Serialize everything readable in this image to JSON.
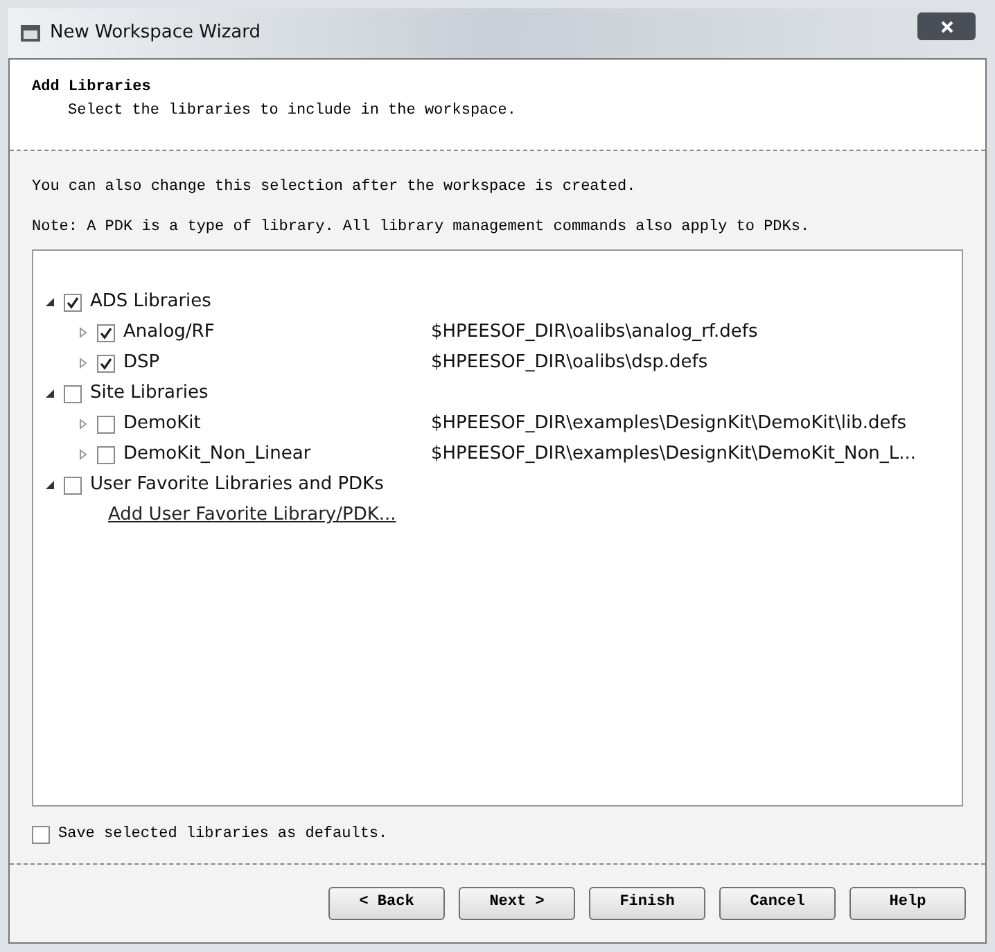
{
  "window": {
    "title": "New Workspace Wizard"
  },
  "header": {
    "title": "Add Libraries",
    "subtitle": "Select the libraries to include in the workspace."
  },
  "notes": [
    "You can also change this selection after the workspace is created.",
    "Note: A PDK is a type of library. All library management commands also apply to PDKs."
  ],
  "tree": [
    {
      "kind": "node",
      "label": "ADS Libraries",
      "checked": true,
      "expanded": true,
      "children": [
        {
          "kind": "node",
          "label": "Analog/RF",
          "path": "$HPEESOF_DIR\\oalibs\\analog_rf.defs",
          "checked": true,
          "expanded": false
        },
        {
          "kind": "node",
          "label": "DSP",
          "path": "$HPEESOF_DIR\\oalibs\\dsp.defs",
          "checked": true,
          "expanded": false
        }
      ]
    },
    {
      "kind": "node",
      "label": "Site Libraries",
      "checked": false,
      "expanded": true,
      "children": [
        {
          "kind": "node",
          "label": "DemoKit",
          "path": "$HPEESOF_DIR\\examples\\DesignKit\\DemoKit\\lib.defs",
          "checked": false,
          "expanded": false
        },
        {
          "kind": "node",
          "label": "DemoKit_Non_Linear",
          "path": "$HPEESOF_DIR\\examples\\DesignKit\\DemoKit_Non_L...",
          "checked": false,
          "expanded": false
        }
      ]
    },
    {
      "kind": "node",
      "label": "User Favorite Libraries and PDKs",
      "checked": false,
      "expanded": true,
      "children": [
        {
          "kind": "link",
          "label": "Add User Favorite Library/PDK..."
        }
      ]
    }
  ],
  "save_defaults": {
    "label": "Save selected libraries as defaults.",
    "checked": false
  },
  "buttons": [
    "< Back",
    "Next >",
    "Finish",
    "Cancel",
    "Help"
  ]
}
